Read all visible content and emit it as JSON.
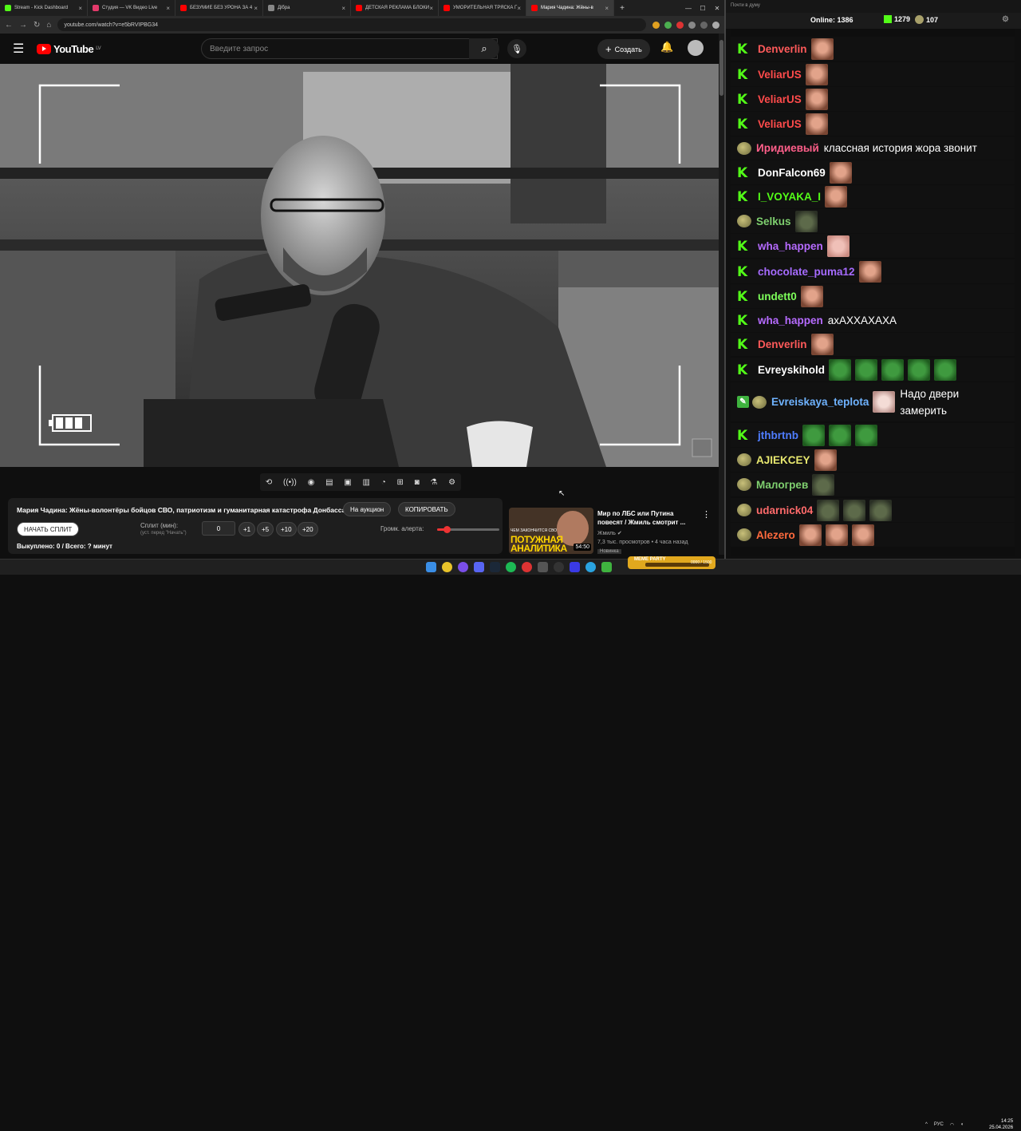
{
  "browser": {
    "tabs": [
      {
        "label": "Stream - Kick Dashboard",
        "color": "#53fc18",
        "active": false
      },
      {
        "label": "Студия — VK Видео Live",
        "color": "#e33a6b",
        "active": false
      },
      {
        "label": "БЕЗУМИЕ БЕЗ УРОНА ЗА 4",
        "color": "#ff0000",
        "active": false
      },
      {
        "label": "Дібра",
        "color": "#888888",
        "active": false
      },
      {
        "label": "ДЕТСКАЯ РЕКЛАМА БЛОКИ",
        "color": "#ff0000",
        "active": false
      },
      {
        "label": "УМОРИТЕЛЬНАЯ ТРЯСКА Г",
        "color": "#ff0000",
        "active": false
      },
      {
        "label": "Мария Чадина: Жёны-в",
        "color": "#ff0000",
        "active": true
      }
    ],
    "url": "youtube.com/watch?v=e5bRVIPBG34"
  },
  "youtube": {
    "logo": "YouTube",
    "region": "LV",
    "search_placeholder": "Введите запрос",
    "create_label": "Создать"
  },
  "panel": {
    "title": "Мария Чадина: Жёны-волонтёры бойцов СВО, патриотизм и гуманитарная катастрофа Донбасса",
    "auction_label": "На аукцион",
    "copy_label": "КОПИРОВАТЬ",
    "start_split_label": "НАЧАТЬ СПЛИТ",
    "split_label": "Сплит (мин):",
    "split_hint": "(уст. перед \"Начать\")",
    "split_value": "0",
    "increments": [
      "+1",
      "+5",
      "+10",
      "+20"
    ],
    "volume_label": "Громк. алерта:",
    "volume_level": 0.15,
    "purchased": "Выкуплено: 0 / Всего: ? минут"
  },
  "recommendation": {
    "title": "Мир по ЛБС или Путина повесят / Жмиль смотрит ...",
    "channel": "Жмиль",
    "meta": "7,3 тыс. просмотров • 4 часа назад",
    "badge": "Новинка",
    "duration": "54:50",
    "thumb_text": "ПОТУЖНАЯ АНАЛИТИКА",
    "thumb_small": "ЧЕМ ЗАКОНЧИТСЯ СВО"
  },
  "chat_header": {
    "title": "Почти в думу",
    "online": "Online: 1386",
    "kick_count": "1279",
    "twitch_count": "107"
  },
  "chat": [
    {
      "platform": "kick",
      "user": "Denverlin",
      "color": "#ff5a5a",
      "text": "",
      "emotes": [
        "face"
      ]
    },
    {
      "platform": "kick",
      "user": "VeliarUS",
      "color": "#ff4b4b",
      "text": "",
      "emotes": [
        "face"
      ]
    },
    {
      "platform": "kick",
      "user": "VeliarUS",
      "color": "#ff4b4b",
      "text": "",
      "emotes": [
        "face"
      ]
    },
    {
      "platform": "kick",
      "user": "VeliarUS",
      "color": "#ff4b4b",
      "text": "",
      "emotes": [
        "face"
      ]
    },
    {
      "platform": "twitch",
      "user": "Иридиевый",
      "color": "#ff5f8a",
      "text": "классная история жора звонит",
      "emotes": []
    },
    {
      "platform": "kick",
      "user": "DonFalcon69",
      "color": "#ffffff",
      "text": "",
      "emotes": [
        "face"
      ]
    },
    {
      "platform": "kick",
      "user": "I_VOYAKA_I",
      "color": "#53fc18",
      "text": "",
      "emotes": [
        "face"
      ]
    },
    {
      "platform": "twitch",
      "user": "Selkus",
      "color": "#7fd06f",
      "text": "",
      "emotes": [
        "blob"
      ]
    },
    {
      "platform": "kick",
      "user": "wha_happen",
      "color": "#b66bff",
      "text": "",
      "emotes": [
        "pink"
      ]
    },
    {
      "platform": "kick",
      "user": "chocolate_puma12",
      "color": "#a66bff",
      "text": "",
      "emotes": [
        "face"
      ]
    },
    {
      "platform": "kick",
      "user": "undett0",
      "color": "#7dff5a",
      "text": "",
      "emotes": [
        "face"
      ]
    },
    {
      "platform": "kick",
      "user": "wha_happen",
      "color": "#b66bff",
      "text": "ахАХХАХАХА",
      "emotes": []
    },
    {
      "platform": "kick",
      "user": "Denverlin",
      "color": "#ff5a5a",
      "text": "",
      "emotes": [
        "face"
      ]
    },
    {
      "platform": "kick",
      "user": "Evreyskihold",
      "color": "#ffffff",
      "text": "",
      "emotes": [
        "frog",
        "frog",
        "frog",
        "frog",
        "frog"
      ]
    },
    {
      "platform": "twitch-mod",
      "user": "Evreiskaya_teplota",
      "color": "#6fb3ff",
      "text": "Надо двери замерить",
      "emotes": [
        "pig"
      ]
    },
    {
      "platform": "kick",
      "user": "jthbrtnb",
      "color": "#4f7dff",
      "text": "",
      "emotes": [
        "frog",
        "frog",
        "frog"
      ]
    },
    {
      "platform": "twitch",
      "user": "AJIEKCEY",
      "color": "#e8e86f",
      "text": "",
      "emotes": [
        "face"
      ]
    },
    {
      "platform": "twitch",
      "user": "Малогрев",
      "color": "#7fd06f",
      "text": "",
      "emotes": [
        "blob"
      ]
    },
    {
      "platform": "twitch",
      "user": "udarnick04",
      "color": "#ff6b6b",
      "text": "",
      "emotes": [
        "blob",
        "blob",
        "blob"
      ]
    },
    {
      "platform": "twitch",
      "user": "Alezero",
      "color": "#ff6a3d",
      "text": "",
      "emotes": [
        "face",
        "face",
        "face"
      ]
    }
  ],
  "taskbar": {
    "meme_party": "MEME PARTY",
    "meme_count": "0000 / 1500",
    "lang": "РУС",
    "time": "14:25",
    "date": "25.04.2026"
  }
}
